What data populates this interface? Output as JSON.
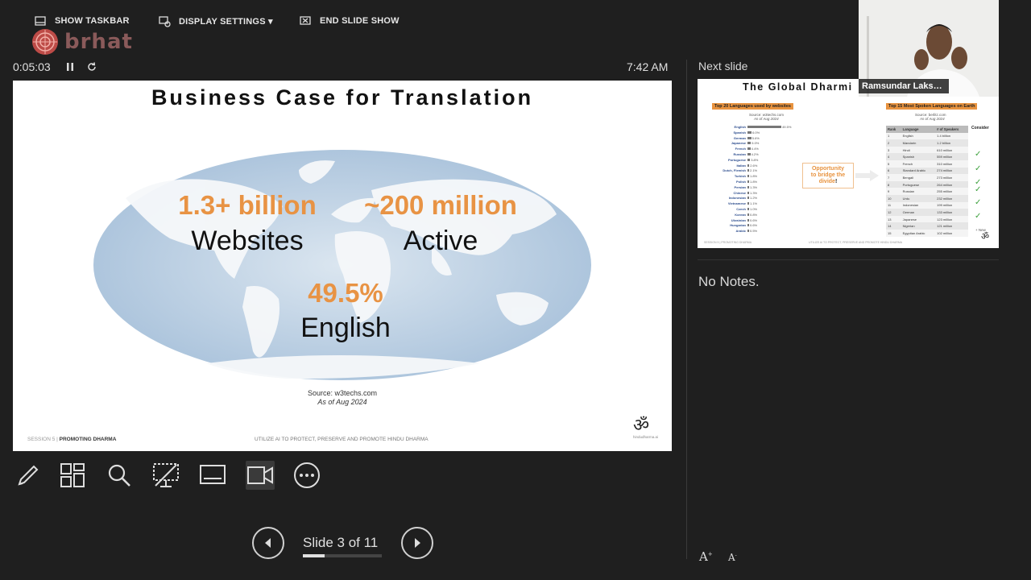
{
  "toolbar": {
    "show_taskbar": "SHOW TASKBAR",
    "display_settings": "DISPLAY SETTINGS ▾",
    "end_show": "END SLIDE SHOW"
  },
  "logo": {
    "text": "brhat"
  },
  "presenter": {
    "elapsed": "0:05:03",
    "clock": "7:42 AM"
  },
  "slide": {
    "title": "Business Case for Translation",
    "stat1_value": "1.3+ billion",
    "stat1_label": "Websites",
    "stat2_value": "~200 million",
    "stat2_label": "Active",
    "stat3_value": "49.5%",
    "stat3_label": "English",
    "source_line1": "Source: w3techs.com",
    "source_line2": "As of Aug 2024",
    "footer_session": "SESSION 5 |",
    "footer_topic": "PROMOTING DHARMA",
    "footer_mid": "UTILIZE AI TO PROTECT, PRESERVE AND PROMOTE HINDU DHARMA",
    "om": "ॐ",
    "om_sub": "hindudharma.ai"
  },
  "tools": [
    "pen-tool",
    "see-all-slides",
    "zoom",
    "black-screen",
    "subtitles",
    "camera",
    "more-options"
  ],
  "navigation": {
    "counter": "Slide 3 of 11",
    "current": 3,
    "total": 11
  },
  "next_slide": {
    "label": "Next slide",
    "title": "The Global Dharmi",
    "left_header": "Top 20 Languages used by websites",
    "left_source": "Source: w3techs.com",
    "left_asof": "As of Aug 2024",
    "right_header": "Top 15 Most Spoken Languages on Earth",
    "right_source": "Source: berlitz.com",
    "right_asof": "As of Aug 2024",
    "opportunity_1": "Opportunity",
    "opportunity_2": "to bridge the",
    "opportunity_3": "divide",
    "opportunity_4": "!",
    "consider": "Consider",
    "foot_left": "SESSION 5 | PROMOTING DHARMA",
    "foot_mid": "UTILIZE AI TO PROTECT, PRESERVE AND PROMOTE HINDU DHARMA",
    "new_mark": "+ New",
    "table_headers": [
      "Rank",
      "Language",
      "# of Speakers"
    ],
    "web_languages": [
      {
        "name": "English",
        "pct": "49.5%",
        "value": 49.5
      },
      {
        "name": "Spanish",
        "pct": "6.0%",
        "value": 6.0
      },
      {
        "name": "German",
        "pct": "5.6%",
        "value": 5.6
      },
      {
        "name": "Japanese",
        "pct": "5.0%",
        "value": 5.0
      },
      {
        "name": "French",
        "pct": "4.4%",
        "value": 4.4
      },
      {
        "name": "Russian",
        "pct": "4.2%",
        "value": 4.2
      },
      {
        "name": "Portuguese",
        "pct": "3.8%",
        "value": 3.8
      },
      {
        "name": "Italian",
        "pct": "2.6%",
        "value": 2.6
      },
      {
        "name": "Dutch, Flemish",
        "pct": "2.1%",
        "value": 2.1
      },
      {
        "name": "Turkish",
        "pct": "1.8%",
        "value": 1.8
      },
      {
        "name": "Polish",
        "pct": "1.8%",
        "value": 1.8
      },
      {
        "name": "Persian",
        "pct": "1.3%",
        "value": 1.3
      },
      {
        "name": "Chinese",
        "pct": "1.3%",
        "value": 1.3
      },
      {
        "name": "Indonesian",
        "pct": "1.2%",
        "value": 1.2
      },
      {
        "name": "Vietnamese",
        "pct": "1.1%",
        "value": 1.1
      },
      {
        "name": "Czech",
        "pct": "1.0%",
        "value": 1.0
      },
      {
        "name": "Korean",
        "pct": "0.8%",
        "value": 0.8
      },
      {
        "name": "Ukrainian",
        "pct": "0.6%",
        "value": 0.6
      },
      {
        "name": "Hungarian",
        "pct": "0.6%",
        "value": 0.6
      },
      {
        "name": "Arabic",
        "pct": "0.5%",
        "value": 0.5
      }
    ],
    "spoken": [
      [
        "1",
        "English",
        "1.4 billion"
      ],
      [
        "2",
        "Mandarin",
        "1.2 billion"
      ],
      [
        "3",
        "Hindi",
        "610 million"
      ],
      [
        "4",
        "Spanish",
        "559 million"
      ],
      [
        "5",
        "French",
        "310 million"
      ],
      [
        "6",
        "Standard Arabic",
        "274 million"
      ],
      [
        "7",
        "Bengali",
        "273 million"
      ],
      [
        "8",
        "Portuguese",
        "264 million"
      ],
      [
        "9",
        "Russian",
        "255 million"
      ],
      [
        "10",
        "Urdu",
        "232 million"
      ],
      [
        "11",
        "Indonesian",
        "199 million"
      ],
      [
        "12",
        "German",
        "133 million"
      ],
      [
        "13",
        "Japanese",
        "123 million"
      ],
      [
        "14",
        "Nigerian",
        "121 million"
      ],
      [
        "15",
        "Egyptian Arabic",
        "102 million"
      ]
    ]
  },
  "video": {
    "name": "Ramsundar Lakshmi..."
  },
  "notes": {
    "text": "No Notes."
  },
  "colors": {
    "accent_orange": "#e8933f",
    "background": "#1f1f1f"
  }
}
